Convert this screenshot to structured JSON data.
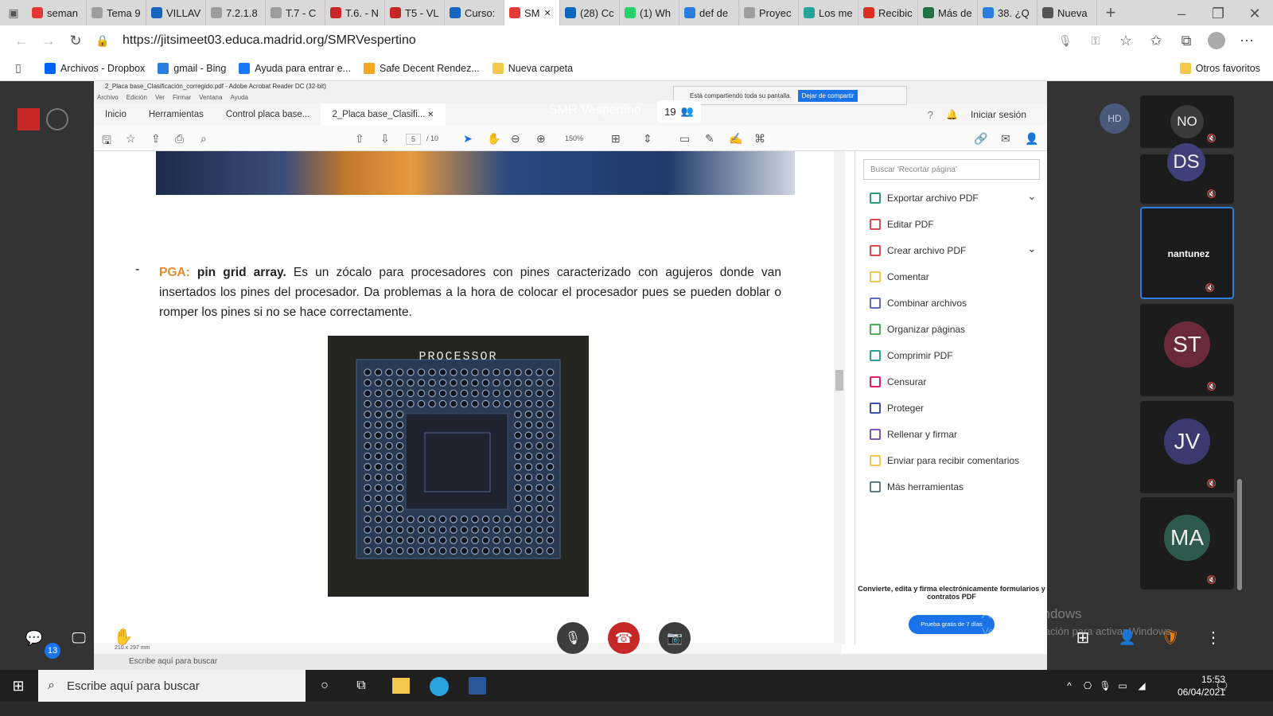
{
  "browser": {
    "tabs": [
      {
        "label": "seman",
        "color": "#e53935"
      },
      {
        "label": "Tema 9",
        "color": "#9e9e9e"
      },
      {
        "label": "VILLAV",
        "color": "#1565c0"
      },
      {
        "label": "7.2.1.8",
        "color": "#9e9e9e"
      },
      {
        "label": "T.7 - C",
        "color": "#9e9e9e"
      },
      {
        "label": "T.6. - N",
        "color": "#c62828"
      },
      {
        "label": "T5 - VL",
        "color": "#c62828"
      },
      {
        "label": "Curso:",
        "color": "#1565c0"
      },
      {
        "label": "SM",
        "color": "#e53935",
        "active": true
      },
      {
        "label": "(28) Cc",
        "color": "#0a66c2"
      },
      {
        "label": "(1) Wh",
        "color": "#25d366"
      },
      {
        "label": "def de",
        "color": "#2a7de1"
      },
      {
        "label": "Proyec",
        "color": "#9e9e9e"
      },
      {
        "label": "Los me",
        "color": "#26a69a"
      },
      {
        "label": "Recibic",
        "color": "#d93025"
      },
      {
        "label": "Más de",
        "color": "#217346"
      },
      {
        "label": "38. ¿Q",
        "color": "#2a7de1"
      },
      {
        "label": "Nueva",
        "color": "#555555"
      }
    ],
    "url": "https://jitsimeet03.educa.madrid.org/SMRVespertino",
    "bookmarks": [
      {
        "label": "Archivos - Dropbox",
        "color": "#0061fe"
      },
      {
        "label": "gmail - Bing",
        "color": "#2a7de1"
      },
      {
        "label": "Ayuda para entrar e...",
        "color": "#1877f2"
      },
      {
        "label": "Safe Decent Rendez...",
        "color": "#f5a623"
      },
      {
        "label": "Nueva carpeta",
        "color": "#f2c94c"
      }
    ],
    "other_favorites": "Otros favoritos"
  },
  "acrobat": {
    "window_title": "2_Placa base_Clasificación_corregido.pdf - Adobe Acrobat Reader DC (32-bit)",
    "menu": [
      "Archivo",
      "Edición",
      "Ver",
      "Firmar",
      "Ventana",
      "Ayuda"
    ],
    "tabs": [
      "Inicio",
      "Herramientas",
      "Control placa base...",
      "2_Placa base_Clasifi..."
    ],
    "sharing_notice": "Está compartiendo toda su pantalla.",
    "stop_sharing": "Dejar de compartir",
    "sign_in": "Iniciar sesión",
    "page_current": "5",
    "page_total": "/ 10",
    "zoom": "150%",
    "paragraph": {
      "label": "PGA:",
      "term": "pin grid array.",
      "text": "Es un zócalo para procesadores con pines caracterizado con agujeros donde van insertados los pines del procesador. Da problemas a la hora de colocar el procesador pues se pueden doblar o romper los pines si no se hace correctamente."
    },
    "processor_label": "PROCESSOR",
    "search_placeholder": "Buscar 'Recortar página'",
    "tools": [
      {
        "label": "Exportar archivo PDF",
        "color": "#2d9d78",
        "expand": true
      },
      {
        "label": "Editar PDF",
        "color": "#e34850"
      },
      {
        "label": "Crear archivo PDF",
        "color": "#e34850",
        "expand": true
      },
      {
        "label": "Comentar",
        "color": "#f2c94c"
      },
      {
        "label": "Combinar archivos",
        "color": "#5c6bc0"
      },
      {
        "label": "Organizar páginas",
        "color": "#4caf50"
      },
      {
        "label": "Comprimir PDF",
        "color": "#26a69a"
      },
      {
        "label": "Censurar",
        "color": "#e91e63"
      },
      {
        "label": "Proteger",
        "color": "#3f51b5"
      },
      {
        "label": "Rellenar y firmar",
        "color": "#7e57c2"
      },
      {
        "label": "Enviar para recibir comentarios",
        "color": "#f2c94c"
      },
      {
        "label": "Más herramientas",
        "color": "#607d8b"
      }
    ],
    "promo_text": "Convierte, edita y firma electrónicamente formularios y contratos PDF",
    "promo_button": "Prueba gratis de 7 días",
    "page_size": "210 x 297 mm"
  },
  "meeting": {
    "title": "SMR Vespertino",
    "participant_count": "19",
    "self_initials": "HD",
    "chat_badge": "13",
    "participants": [
      {
        "initials": "NO",
        "color": "#3a3a3a"
      },
      {
        "initials": "DS",
        "color": "#3f3f7a"
      },
      {
        "initials": "nantunez",
        "color": "#2a2a2a",
        "label": true
      },
      {
        "initials": "ST",
        "color": "#6b2a3a"
      },
      {
        "initials": "JV",
        "color": "#3a3a6e"
      },
      {
        "initials": "MA",
        "color": "#2e5a4e"
      }
    ],
    "watermark_title": "Activar Windows",
    "watermark_sub": "Ve a Configuración para activar Windows."
  },
  "taskbar": {
    "search": "Escribe aquí para buscar",
    "time": "15:53",
    "date": "06/04/2021"
  }
}
